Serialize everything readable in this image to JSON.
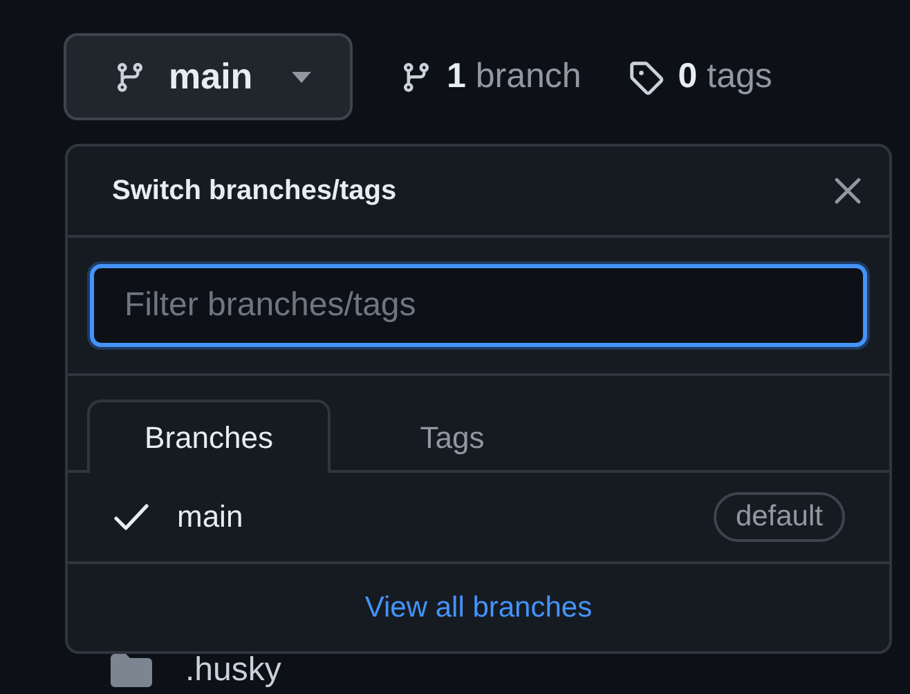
{
  "branch_button": {
    "label": "main"
  },
  "branch_count": "**1** branch",
  "tag_count": "**0** tags",
  "dropdown": {
    "title": "Switch branches/tags",
    "filter": {
      "placeholder": "Filter branches/tags"
    },
    "tabs": [
      {
        "label": "Branches",
        "selected": true
      },
      {
        "label": "Tags",
        "selected": false
      }
    ],
    "branches": [
      {
        "name": "main",
        "selected": true,
        "badge": "default"
      }
    ],
    "footer_link": "View all branches"
  },
  "files": [
    {
      "name": ".husky"
    }
  ]
}
